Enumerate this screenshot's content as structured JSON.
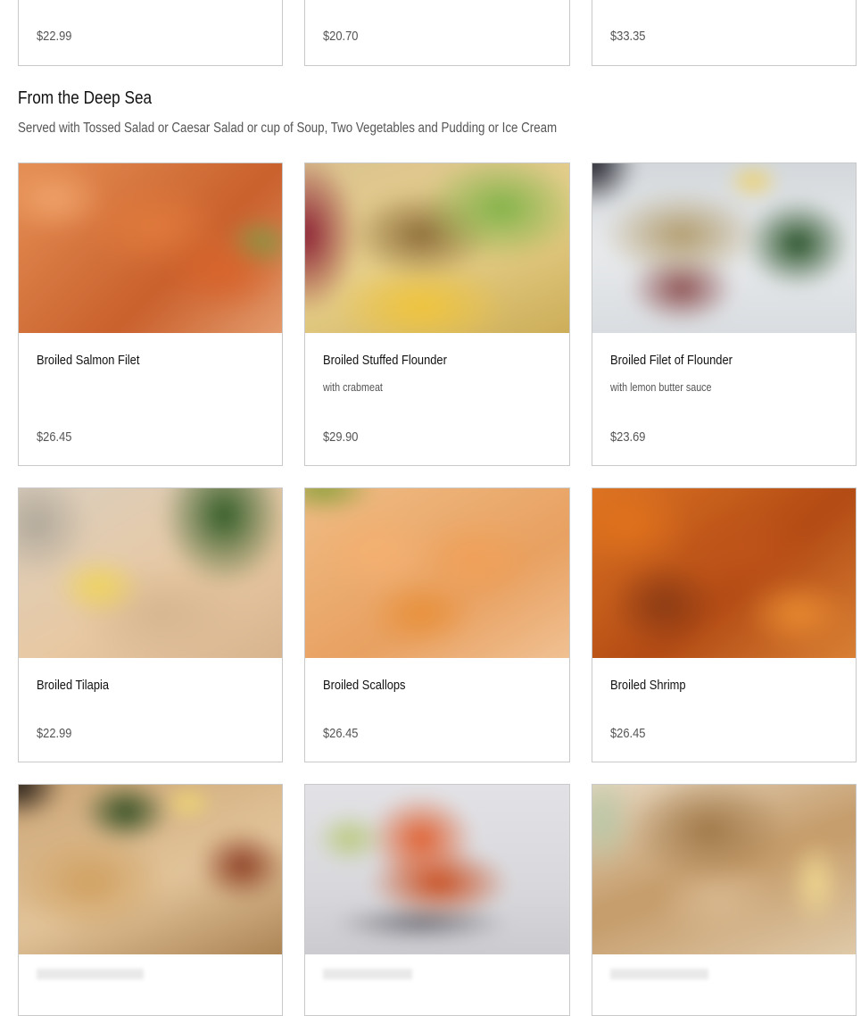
{
  "top_row": {
    "prices": [
      "$22.99",
      "$20.70",
      "$33.35"
    ]
  },
  "section": {
    "title": "From the Deep Sea",
    "subtitle": "Served with Tossed Salad or Caesar Salad or cup of Soup, Two Vegetables and Pudding or Ice Cream"
  },
  "items": [
    {
      "name": "Broiled Salmon Filet",
      "description": "",
      "price": "$26.45",
      "image_icon": "salmon-photo"
    },
    {
      "name": "Broiled Stuffed Flounder",
      "description": "with crabmeat",
      "price": "$29.90",
      "image_icon": "flounder-photo"
    },
    {
      "name": "Broiled Filet of Flounder",
      "description": "with lemon butter sauce",
      "price": "$23.69",
      "image_icon": "flounder-filet-photo"
    },
    {
      "name": "Broiled Tilapia",
      "description": "",
      "price": "$22.99",
      "image_icon": "tilapia-photo"
    },
    {
      "name": "Broiled Scallops",
      "description": "",
      "price": "$26.45",
      "image_icon": "scallops-photo"
    },
    {
      "name": "Broiled Shrimp",
      "description": "",
      "price": "$26.45",
      "image_icon": "shrimp-photo"
    }
  ],
  "colors": {
    "border": "#c9c9c9",
    "price_text": "#555555",
    "name_text": "#111111"
  }
}
